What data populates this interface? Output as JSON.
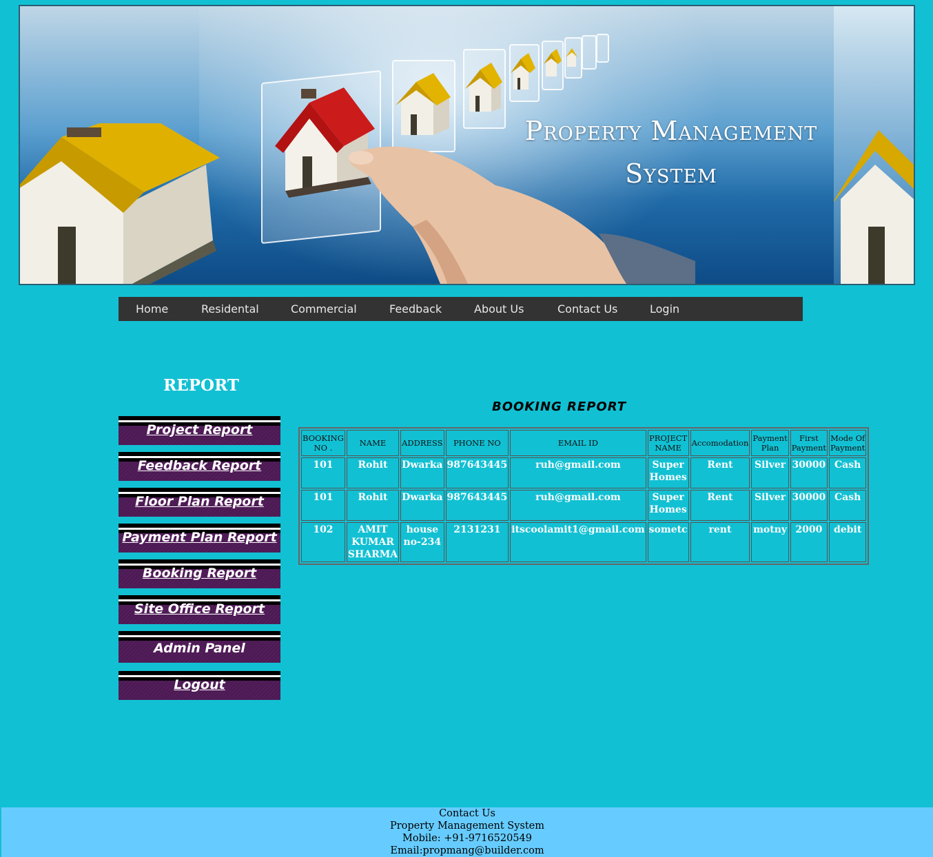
{
  "banner": {
    "title_line1": "Property Management",
    "title_line2": "System"
  },
  "nav": {
    "items": [
      "Home",
      "Residental",
      "Commercial",
      "Feedback",
      "About Us",
      "Contact Us",
      "Login"
    ]
  },
  "sidebar": {
    "heading": "REPORT",
    "items": [
      "Project Report",
      "Feedback Report",
      "Floor Plan Report",
      "Payment Plan Report",
      "Booking Report",
      "Site Office Report",
      "Admin Panel",
      "Logout"
    ]
  },
  "report": {
    "title": "BOOKING REPORT",
    "headers": [
      "BOOKING NO .",
      "NAME",
      "ADDRESS",
      "PHONE NO",
      "EMAIL ID",
      "PROJECT NAME",
      "Accomodation",
      "Payment Plan",
      "First Payment",
      "Mode Of Payment"
    ],
    "rows": [
      [
        "101",
        "Rohit",
        "Dwarka",
        "987643445",
        "ruh@gmail.com",
        "Super Homes",
        "Rent",
        "Silver",
        "30000",
        "Cash"
      ],
      [
        "101",
        "Rohit",
        "Dwarka",
        "987643445",
        "ruh@gmail.com",
        "Super Homes",
        "Rent",
        "Silver",
        "30000",
        "Cash"
      ],
      [
        "102",
        "AMIT KUMAR SHARMA",
        "house no-234",
        "2131231",
        "itscoolamit1@gmail.com",
        "sometc",
        "rent",
        "motny",
        "2000",
        "debit"
      ]
    ]
  },
  "footer": {
    "line1": "Contact Us",
    "line2": "Property Management System",
    "line3": "Mobile: +91-9716520549",
    "line4": "Email:propmang@builder.com"
  }
}
